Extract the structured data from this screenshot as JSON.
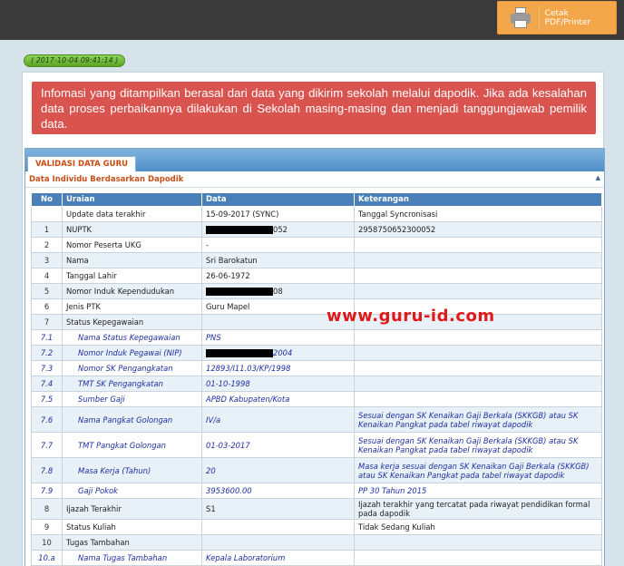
{
  "toolbar": {
    "print_label": "Cetak PDF/Printer"
  },
  "timestamp": "( 2017-10-04 09:41:14 )",
  "alert": {
    "text": "Infomasi yang ditampilkan berasal dari data yang dikirim sekolah melalui dapodik. Jika ada kesalahan data proses perbaikannya dilakukan di Sekolah masing-masing dan menjadi tanggungjawab pemilik data."
  },
  "section": {
    "tab": "VALIDASI DATA GURU",
    "subtitle": "Data Individu Berdasarkan Dapodik",
    "collapse_icon": "chevron-up-icon"
  },
  "table": {
    "headers": [
      "No",
      "Uraian",
      "Data",
      "Keterangan"
    ],
    "rows": [
      {
        "no": "",
        "uraian": "Update data terakhir",
        "data": "15-09-2017 (SYNC)",
        "ket": "Tanggal Syncronisasi"
      },
      {
        "no": "1",
        "uraian": "NUPTK",
        "data": "052",
        "ket": "2958750652300052"
      },
      {
        "no": "2",
        "uraian": "Nomor Peserta UKG",
        "data": "-",
        "ket": ""
      },
      {
        "no": "3",
        "uraian": "Nama",
        "data": "Sri Barokatun",
        "ket": ""
      },
      {
        "no": "4",
        "uraian": "Tanggal Lahir",
        "data": "26-06-1972",
        "ket": ""
      },
      {
        "no": "5",
        "uraian": "Nomor Induk Kependudukan",
        "data": "08",
        "ket": ""
      },
      {
        "no": "6",
        "uraian": "Jenis PTK",
        "data": "Guru Mapel",
        "ket": ""
      },
      {
        "no": "7",
        "uraian": "Status Kepegawaian",
        "data": "",
        "ket": ""
      },
      {
        "no": "7.1",
        "uraian": "Nama Status Kepegawaian",
        "data": "PNS",
        "ket": ""
      },
      {
        "no": "7.2",
        "uraian": "Nomor Induk Pegawai (NIP)",
        "data": "2004",
        "ket": ""
      },
      {
        "no": "7.3",
        "uraian": "Nomor SK Pengangkatan",
        "data": "12893/I11.03/KP/1998",
        "ket": ""
      },
      {
        "no": "7.4",
        "uraian": "TMT SK Pengangkatan",
        "data": "01-10-1998",
        "ket": ""
      },
      {
        "no": "7.5",
        "uraian": "Sumber Gaji",
        "data": "APBD Kabupaten/Kota",
        "ket": ""
      },
      {
        "no": "7.6",
        "uraian": "Nama Pangkat Golongan",
        "data": "IV/a",
        "ket": "Sesuai dengan SK Kenaikan Gaji Berkala (SKKGB) atau SK Kenaikan Pangkat pada tabel riwayat dapodik"
      },
      {
        "no": "7.7",
        "uraian": "TMT Pangkat Golongan",
        "data": "01-03-2017",
        "ket": "Sesuai dengan SK Kenaikan Gaji Berkala (SKKGB) atau SK Kenaikan Pangkat pada tabel riwayat dapodik"
      },
      {
        "no": "7.8",
        "uraian": "Masa Kerja (Tahun)",
        "data": "20",
        "ket": "Masa kerja sesuai dengan SK Kenaikan Gaji Berkala (SKKGB) atau SK Kenaikan Pangkat pada tabel riwayat dapodik"
      },
      {
        "no": "7.9",
        "uraian": "Gaji Pokok",
        "data": "3953600.00",
        "ket": "PP 30 Tahun 2015"
      },
      {
        "no": "8",
        "uraian": "Ijazah Terakhir",
        "data": "S1",
        "ket": "Ijazah terakhir yang tercatat pada riwayat pendidikan formal pada dapodik"
      },
      {
        "no": "9",
        "uraian": "Status Kuliah",
        "data": "",
        "ket": "Tidak Sedang Kuliah"
      },
      {
        "no": "10",
        "uraian": "Tugas Tambahan",
        "data": "",
        "ket": ""
      },
      {
        "no": "10.a",
        "uraian": "Nama Tugas Tambahan",
        "data": "Kepala Laboratorium",
        "ket": ""
      }
    ]
  },
  "watermark": "www.guru-id.com"
}
